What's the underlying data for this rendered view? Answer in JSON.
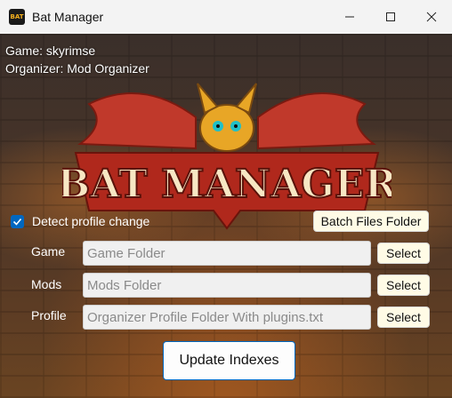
{
  "window": {
    "title": "Bat Manager",
    "icon_text": "BAT",
    "controls": {
      "minimize": "minimize-icon",
      "maximize": "maximize-icon",
      "close": "close-icon"
    }
  },
  "info": {
    "game": "Game: skyrimse",
    "organizer": "Organizer: Mod Organizer"
  },
  "logo": {
    "text": "BAT MANAGER"
  },
  "detect_profile": {
    "label": "Detect profile change",
    "checked": true
  },
  "batch_files_button": "Batch Files Folder",
  "rows": [
    {
      "label": "Game",
      "placeholder": "Game Folder",
      "button": "Select"
    },
    {
      "label": "Mods",
      "placeholder": "Mods Folder",
      "button": "Select"
    },
    {
      "label": "Profile",
      "placeholder": "Organizer Profile Folder With plugins.txt",
      "button": "Select"
    }
  ],
  "update_button": "Update Indexes",
  "colors": {
    "accent": "#0067c0",
    "button_bg": "#fffbe6",
    "logo_fill": "#f7e7c4",
    "logo_outline": "#b0281c"
  }
}
